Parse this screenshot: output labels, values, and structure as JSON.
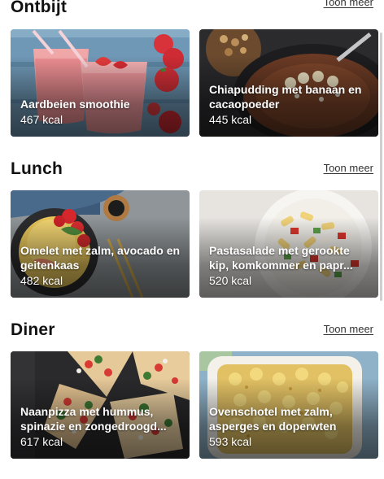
{
  "sections": [
    {
      "title": "Ontbijt",
      "see_more": "Toon meer",
      "cards": [
        {
          "title": "Aardbeien smoothie",
          "kcal": "467 kcal",
          "image": "strawberry-smoothie-photo"
        },
        {
          "title": "Chiapudding met banaan en cacaopoeder",
          "kcal": "445 kcal",
          "image": "chia-pudding-photo"
        }
      ]
    },
    {
      "title": "Lunch",
      "see_more": "Toon meer",
      "cards": [
        {
          "title": "Omelet met zalm, avocado en geitenkaas",
          "kcal": "482 kcal",
          "image": "omelet-photo"
        },
        {
          "title": "Pastasalade met gerookte kip, komkommer en papr...",
          "kcal": "520 kcal",
          "image": "pasta-salad-photo"
        }
      ]
    },
    {
      "title": "Diner",
      "see_more": "Toon meer",
      "cards": [
        {
          "title": "Naanpizza met hummus, spinazie en zongedroogd...",
          "kcal": "617 kcal",
          "image": "naan-pizza-photo"
        },
        {
          "title": "Ovenschotel met zalm, asperges en doperwten",
          "kcal": "593 kcal",
          "image": "oven-dish-photo"
        }
      ]
    }
  ]
}
